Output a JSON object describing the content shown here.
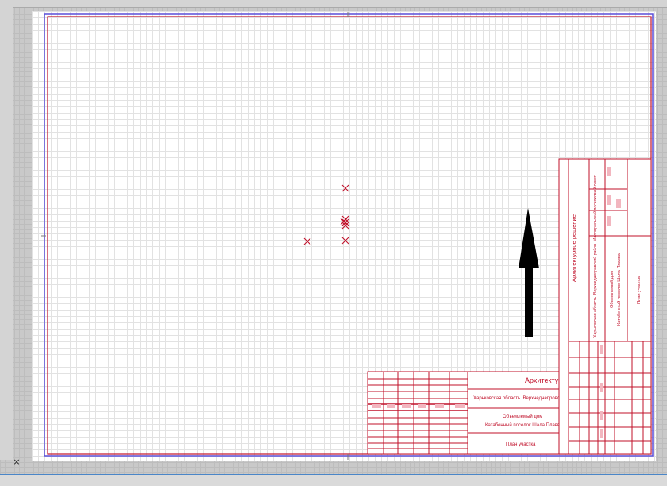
{
  "app": {
    "close_glyph": "×"
  },
  "colors": {
    "frame_red": "#c0102a",
    "frame_blue": "#5a4fd8",
    "stamp_fill": "#f2b6bf",
    "arrow": "#000000"
  },
  "drawing": {
    "markers": [
      "x-marker",
      "x-marker",
      "x-marker",
      "x-marker",
      "x-marker",
      "x-marker",
      "x-marker"
    ],
    "north_arrow": "arrow-up"
  },
  "title_block": {
    "main": {
      "project_title": "Архитектурная",
      "address": "Харьковская область. Верхнеднепровский район",
      "object_line1": "Объемлемый дом",
      "object_line2": "Катабенный поселок Шала Плавва",
      "sheet_name": "План участка"
    },
    "side": {
      "project_title": "Архитектурное решение",
      "address": "Харьковская область. Верхнеднепровский район. Малоприльский поселковый совет",
      "object_line1": "Объемлемый дом",
      "object_line2": "Катабенный поселок Шала Плавва",
      "sheet_name": "План участка"
    }
  }
}
